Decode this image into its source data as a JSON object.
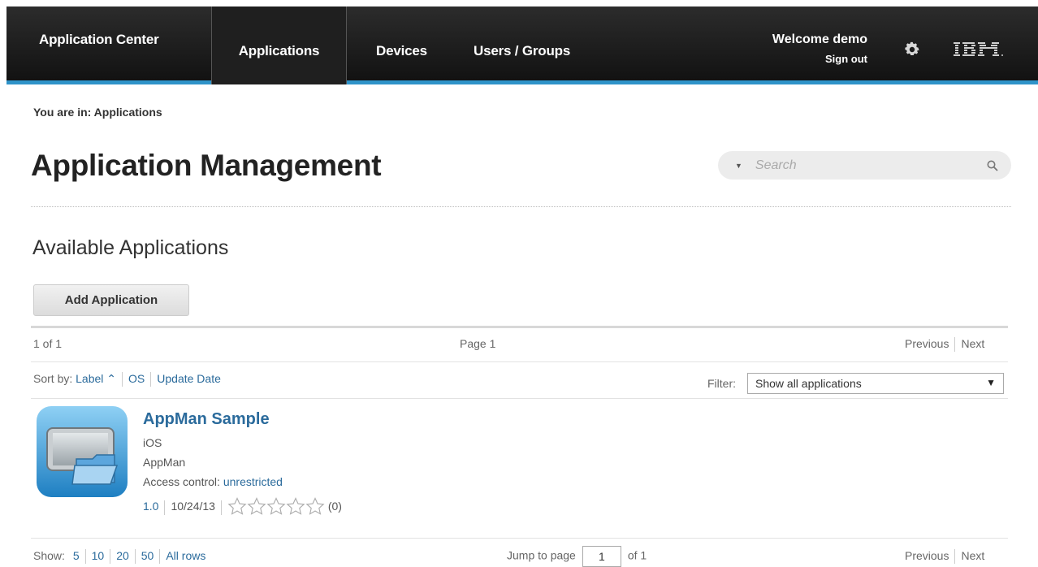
{
  "header": {
    "brand": "Application Center",
    "nav": [
      "Applications",
      "Devices",
      "Users / Groups"
    ],
    "welcome": "Welcome demo",
    "signout": "Sign out",
    "accent_color": "#2f93c9"
  },
  "breadcrumb": "You are in: Applications",
  "page_title": "Application Management",
  "search": {
    "placeholder": "Search"
  },
  "section_title": "Available Applications",
  "add_button": "Add Application",
  "pager_top": {
    "count": "1 of 1",
    "page": "Page 1",
    "previous": "Previous",
    "next": "Next"
  },
  "sort": {
    "label": "Sort by:",
    "options": [
      "Label",
      "OS",
      "Update Date"
    ]
  },
  "filter": {
    "label": "Filter:",
    "selected": "Show all applications"
  },
  "app": {
    "name": "AppMan Sample",
    "os": "iOS",
    "package": "AppMan",
    "access_label": "Access control:",
    "access_value": "unrestricted",
    "version": "1.0",
    "date": "10/24/13",
    "rating_count": "(0)",
    "rating": 0,
    "rating_max": 5
  },
  "pager_bottom": {
    "show_label": "Show:",
    "sizes": [
      "5",
      "10",
      "20",
      "50",
      "All rows"
    ],
    "jump_label": "Jump to page",
    "jump_value": "1",
    "of_pages": "of 1",
    "previous": "Previous",
    "next": "Next"
  }
}
